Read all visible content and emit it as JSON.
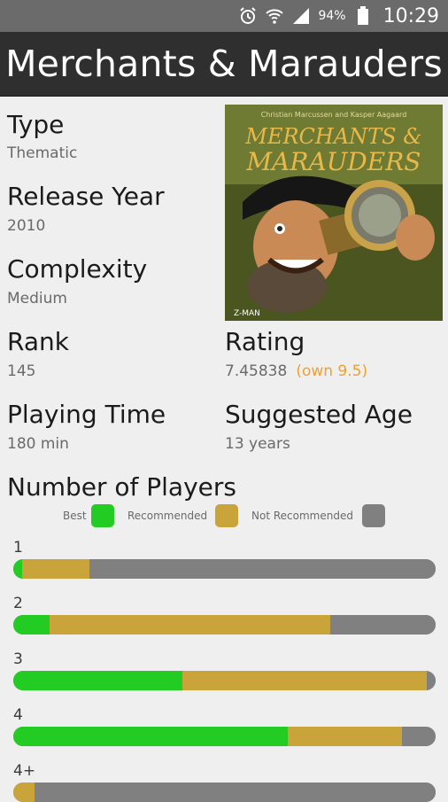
{
  "status_bar": {
    "battery": "94%",
    "time": "10:29",
    "icons": [
      "alarm-icon",
      "wifi-icon",
      "signal-icon",
      "battery-icon"
    ]
  },
  "app_bar": {
    "title": "Merchants & Marauders"
  },
  "cover_image": {
    "title_text": "Merchants & Marauders",
    "subtitle_text": "Christian Marcussen and Kasper Aagaard",
    "publisher_mark": "Z-MAN"
  },
  "details": {
    "type": {
      "label": "Type",
      "value": "Thematic"
    },
    "release_year": {
      "label": "Release Year",
      "value": "2010"
    },
    "complexity": {
      "label": "Complexity",
      "value": "Medium"
    },
    "rank": {
      "label": "Rank",
      "value": "145"
    },
    "rating": {
      "label": "Rating",
      "value": "7.45838",
      "own": "(own 9.5)"
    },
    "playing_time": {
      "label": "Playing Time",
      "value": "180 min"
    },
    "suggested_age": {
      "label": "Suggested Age",
      "value": "13 years"
    }
  },
  "players": {
    "title": "Number of Players",
    "legend": [
      {
        "label": "Best",
        "color": "#22cc22"
      },
      {
        "label": "Recommended",
        "color": "#c9a43a"
      },
      {
        "label": "Not Recommended",
        "color": "#808080"
      }
    ],
    "rows": [
      {
        "label": "1",
        "best": 0.02,
        "recommended": 0.16,
        "not_recommended": 0.82
      },
      {
        "label": "2",
        "best": 0.085,
        "recommended": 0.665,
        "not_recommended": 0.25
      },
      {
        "label": "3",
        "best": 0.4,
        "recommended": 0.58,
        "not_recommended": 0.02
      },
      {
        "label": "4",
        "best": 0.65,
        "recommended": 0.27,
        "not_recommended": 0.08
      },
      {
        "label": "4+",
        "best": 0.0,
        "recommended": 0.05,
        "not_recommended": 0.95
      }
    ]
  }
}
